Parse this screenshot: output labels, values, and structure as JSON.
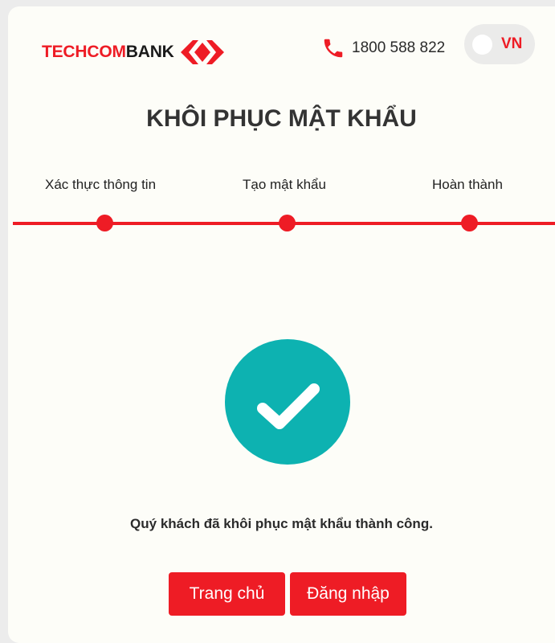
{
  "header": {
    "brand": {
      "part1": "TECHCOM",
      "part2": "BANK"
    },
    "hotline": "1800 588 822",
    "language": "VN"
  },
  "page": {
    "title": "KHÔI PHỤC MẬT KHẨU"
  },
  "stepper": {
    "steps": [
      {
        "label": "Xác thực thông tin"
      },
      {
        "label": "Tạo mật khẩu"
      },
      {
        "label": "Hoàn thành"
      }
    ]
  },
  "result": {
    "message": "Quý khách đã khôi phục mật khẩu thành công."
  },
  "actions": {
    "home_label": "Trang chủ",
    "login_label": "Đăng nhập"
  },
  "colors": {
    "brand_red": "#ee1c25",
    "success_teal": "#0db2b1",
    "card_bg": "#fdfdf8"
  },
  "icons": {
    "phone": "phone-icon",
    "success": "check-circle-icon"
  }
}
